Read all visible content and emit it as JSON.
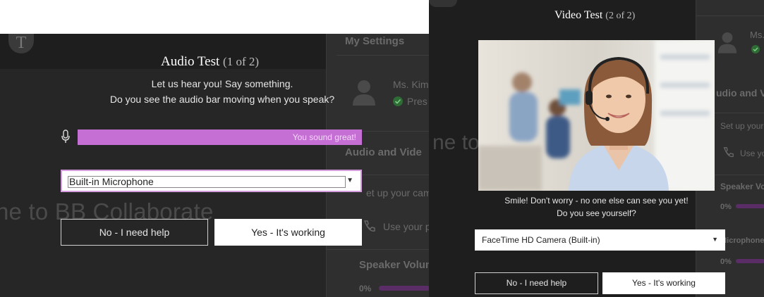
{
  "audio_test": {
    "background": {
      "welcome_text": "ne to BB Collaborate",
      "welcome_text_right": "ne to",
      "settings": {
        "title": "My Settings",
        "user_name": "Ms. Kim",
        "presence": "Pres",
        "section": "Audio and Vide",
        "setup_text": "et up your cam",
        "use_text": "Use your p",
        "speaker_volume": "Speaker Volume",
        "volume_pct": "0%"
      }
    },
    "title": "Audio Test",
    "step": "(1 of 2)",
    "instruction_line1": "Let us hear you! Say something.",
    "instruction_line2": "Do you see the audio bar moving when you speak?",
    "audio_bar_label": "You sound great!",
    "audio_level": 1.0,
    "microphone_select": "Built-in Microphone",
    "no_button": "No - I need help",
    "yes_button": "Yes - It's working"
  },
  "video_test": {
    "background": {
      "settings": {
        "user_name": "Ms.",
        "section": "udio and V",
        "setup_text": "Set up your",
        "use_text": "Use yo",
        "speaker_volume": "Speaker Vo",
        "volume_pct": "0%",
        "microphone_label": "Microphone",
        "mic_pct": "0%"
      }
    },
    "title": "Video Test",
    "step": "(2 of 2)",
    "instruction_line1": "Smile! Don't worry - no one else can see you yet!",
    "instruction_line2": "Do you see yourself?",
    "camera_select": "FaceTime HD Camera (Built-in)",
    "no_button": "No - I need help",
    "yes_button": "Yes - It's working"
  },
  "colors": {
    "audio_bar": "#c56fd5",
    "presence_green": "#2e8b3a",
    "overlay": "#1e1e1e"
  }
}
